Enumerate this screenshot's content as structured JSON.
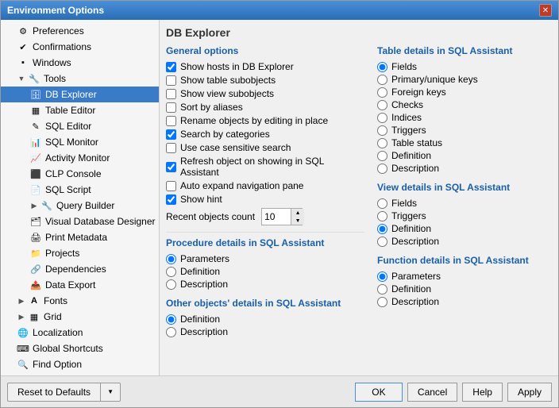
{
  "window": {
    "title": "Environment Options",
    "close_icon": "✕"
  },
  "sidebar": {
    "items": [
      {
        "label": "Preferences",
        "icon": "⚙",
        "indent": 1,
        "type": "item"
      },
      {
        "label": "Confirmations",
        "icon": "✔",
        "indent": 1,
        "type": "item"
      },
      {
        "label": "Windows",
        "icon": "▪",
        "indent": 1,
        "type": "item"
      },
      {
        "label": "Tools",
        "icon": "🔧",
        "indent": 1,
        "type": "expand",
        "expanded": true
      },
      {
        "label": "DB Explorer",
        "icon": "🗄",
        "indent": 2,
        "type": "item",
        "selected": true
      },
      {
        "label": "Table Editor",
        "icon": "▦",
        "indent": 2,
        "type": "item"
      },
      {
        "label": "SQL Editor",
        "icon": "✎",
        "indent": 2,
        "type": "item"
      },
      {
        "label": "SQL Monitor",
        "icon": "📊",
        "indent": 2,
        "type": "item"
      },
      {
        "label": "Activity Monitor",
        "icon": "📈",
        "indent": 2,
        "type": "item"
      },
      {
        "label": "CLP Console",
        "icon": "⬛",
        "indent": 2,
        "type": "item"
      },
      {
        "label": "SQL Script",
        "icon": "📄",
        "indent": 2,
        "type": "item"
      },
      {
        "label": "Query Builder",
        "icon": "🔧",
        "indent": 2,
        "type": "expand"
      },
      {
        "label": "Visual Database Designer",
        "icon": "🗂",
        "indent": 2,
        "type": "item"
      },
      {
        "label": "Print Metadata",
        "icon": "🖨",
        "indent": 2,
        "type": "item"
      },
      {
        "label": "Projects",
        "icon": "📁",
        "indent": 2,
        "type": "item"
      },
      {
        "label": "Dependencies",
        "icon": "🔗",
        "indent": 2,
        "type": "item"
      },
      {
        "label": "Data Export",
        "icon": "📤",
        "indent": 2,
        "type": "item"
      },
      {
        "label": "Fonts",
        "icon": "A",
        "indent": 1,
        "type": "expand"
      },
      {
        "label": "Grid",
        "icon": "▦",
        "indent": 1,
        "type": "expand"
      },
      {
        "label": "Localization",
        "icon": "🌐",
        "indent": 1,
        "type": "item"
      },
      {
        "label": "Global Shortcuts",
        "icon": "⌨",
        "indent": 1,
        "type": "item"
      },
      {
        "label": "Find Option",
        "icon": "🔍",
        "indent": 1,
        "type": "item"
      }
    ]
  },
  "panel": {
    "title": "DB Explorer",
    "general_options": {
      "label": "General options",
      "checkboxes": [
        {
          "label": "Show hosts in DB Explorer",
          "checked": true
        },
        {
          "label": "Show table subobjects",
          "checked": false
        },
        {
          "label": "Show view subobjects",
          "checked": false
        },
        {
          "label": "Sort by aliases",
          "checked": false
        },
        {
          "label": "Rename objects by editing in place",
          "checked": false
        },
        {
          "label": "Search by categories",
          "checked": true
        },
        {
          "label": "Use case sensitive search",
          "checked": false
        },
        {
          "label": "Refresh object on showing in SQL Assistant",
          "checked": true
        },
        {
          "label": "Auto expand navigation pane",
          "checked": false
        },
        {
          "label": "Show hint",
          "checked": true
        }
      ],
      "recent_objects_label": "Recent objects count",
      "recent_objects_value": "10"
    },
    "procedure_details": {
      "label": "Procedure details in SQL Assistant",
      "options": [
        {
          "label": "Parameters",
          "selected": true
        },
        {
          "label": "Definition",
          "selected": false
        },
        {
          "label": "Description",
          "selected": false
        }
      ]
    },
    "other_objects": {
      "label": "Other objects' details in SQL Assistant",
      "options": [
        {
          "label": "Definition",
          "selected": true
        },
        {
          "label": "Description",
          "selected": false
        }
      ]
    },
    "table_details": {
      "label": "Table details in SQL Assistant",
      "options": [
        {
          "label": "Fields",
          "selected": true
        },
        {
          "label": "Primary/unique keys",
          "selected": false
        },
        {
          "label": "Foreign keys",
          "selected": false
        },
        {
          "label": "Checks",
          "selected": false
        },
        {
          "label": "Indices",
          "selected": false
        },
        {
          "label": "Triggers",
          "selected": false
        },
        {
          "label": "Table status",
          "selected": false
        },
        {
          "label": "Definition",
          "selected": false
        },
        {
          "label": "Description",
          "selected": false
        }
      ]
    },
    "view_details": {
      "label": "View details in SQL Assistant",
      "options": [
        {
          "label": "Fields",
          "selected": false
        },
        {
          "label": "Triggers",
          "selected": false
        },
        {
          "label": "Definition",
          "selected": true
        },
        {
          "label": "Description",
          "selected": false
        }
      ]
    },
    "function_details": {
      "label": "Function details in SQL Assistant",
      "options": [
        {
          "label": "Parameters",
          "selected": true
        },
        {
          "label": "Definition",
          "selected": false
        },
        {
          "label": "Description",
          "selected": false
        }
      ]
    }
  },
  "bottom": {
    "reset_label": "Reset to Defaults",
    "arrow": "▼",
    "ok_label": "OK",
    "cancel_label": "Cancel",
    "help_label": "Help",
    "apply_label": "Apply"
  }
}
